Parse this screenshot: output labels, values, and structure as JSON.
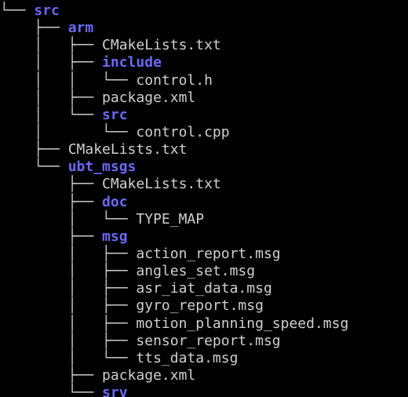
{
  "colors": {
    "background": "#000000",
    "directory": "#6a6af5",
    "file": "#d0d0d0"
  },
  "tree": [
    {
      "prefix": "└── ",
      "name": "src",
      "type": "dir"
    },
    {
      "prefix": "    ├── ",
      "name": "arm",
      "type": "dir"
    },
    {
      "prefix": "    │   ├── ",
      "name": "CMakeLists.txt",
      "type": "file"
    },
    {
      "prefix": "    │   ├── ",
      "name": "include",
      "type": "dir"
    },
    {
      "prefix": "    │   │   └── ",
      "name": "control.h",
      "type": "file"
    },
    {
      "prefix": "    │   ├── ",
      "name": "package.xml",
      "type": "file"
    },
    {
      "prefix": "    │   └── ",
      "name": "src",
      "type": "dir"
    },
    {
      "prefix": "    │       └── ",
      "name": "control.cpp",
      "type": "file"
    },
    {
      "prefix": "    ├── ",
      "name": "CMakeLists.txt",
      "type": "file"
    },
    {
      "prefix": "    └── ",
      "name": "ubt_msgs",
      "type": "dir"
    },
    {
      "prefix": "        ├── ",
      "name": "CMakeLists.txt",
      "type": "file"
    },
    {
      "prefix": "        ├── ",
      "name": "doc",
      "type": "dir"
    },
    {
      "prefix": "        │   └── ",
      "name": "TYPE_MAP",
      "type": "file"
    },
    {
      "prefix": "        ├── ",
      "name": "msg",
      "type": "dir"
    },
    {
      "prefix": "        │   ├── ",
      "name": "action_report.msg",
      "type": "file"
    },
    {
      "prefix": "        │   ├── ",
      "name": "angles_set.msg",
      "type": "file"
    },
    {
      "prefix": "        │   ├── ",
      "name": "asr_iat_data.msg",
      "type": "file"
    },
    {
      "prefix": "        │   ├── ",
      "name": "gyro_report.msg",
      "type": "file"
    },
    {
      "prefix": "        │   ├── ",
      "name": "motion_planning_speed.msg",
      "type": "file"
    },
    {
      "prefix": "        │   ├── ",
      "name": "sensor_report.msg",
      "type": "file"
    },
    {
      "prefix": "        │   └── ",
      "name": "tts_data.msg",
      "type": "file"
    },
    {
      "prefix": "        ├── ",
      "name": "package.xml",
      "type": "file"
    },
    {
      "prefix": "        └── ",
      "name": "srv",
      "type": "dir"
    }
  ]
}
